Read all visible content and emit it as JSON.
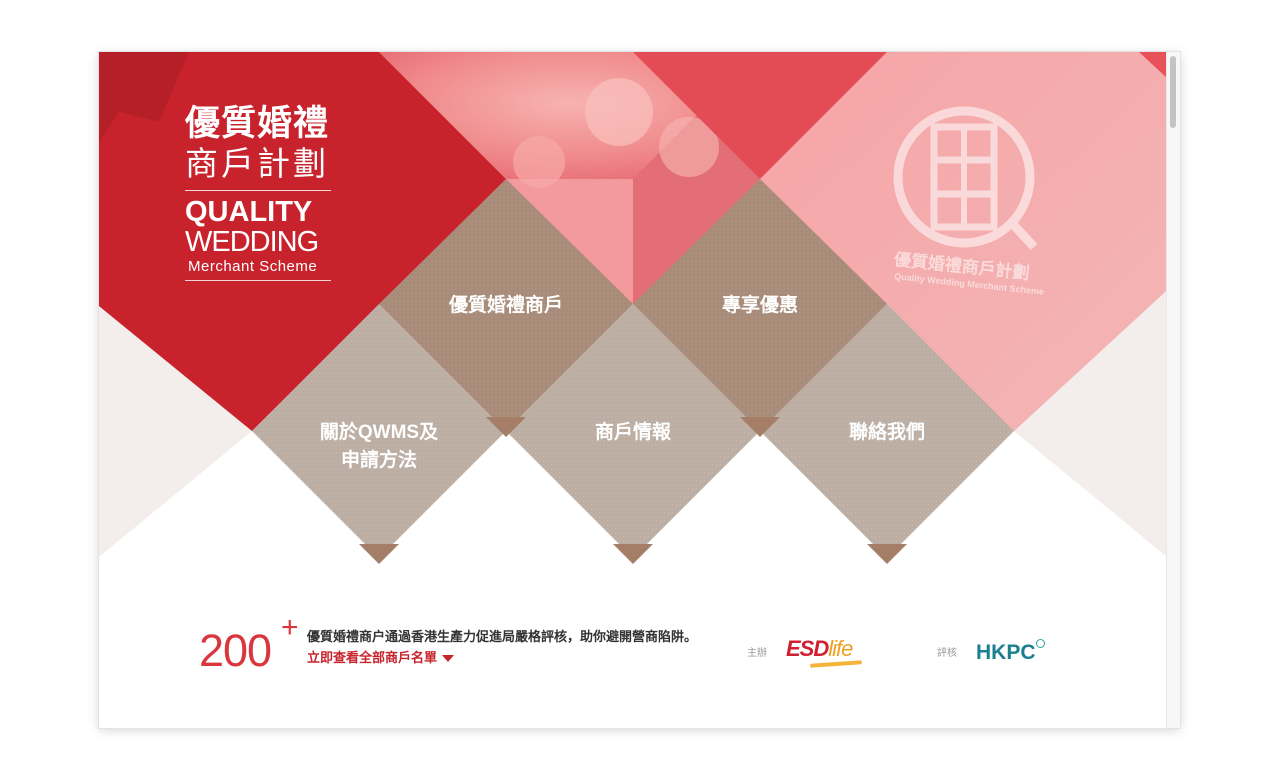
{
  "logo": {
    "title_zh_line1": "優質婚禮",
    "title_zh_line2": "商戶計劃",
    "title_en_line1": "QUALITY",
    "title_en_line2": "WEDDING",
    "title_en_line3": "Merchant Scheme"
  },
  "hero_stamp": {
    "zh": "優質婚禮商戶計劃",
    "en": "Quality Wedding Merchant Scheme"
  },
  "nav": {
    "merchants": "優質婚禮商戶",
    "offers": "專享優惠",
    "about_line1": "關於QWMS及",
    "about_line2": "申請方法",
    "merchant_info": "商戶情報",
    "contact": "聯絡我們"
  },
  "footer": {
    "count": "200",
    "count_suffix": "+",
    "description": "優質婚禮商户通過香港生產力促進局嚴格評核，助你避開營商陷阱。",
    "view_all_link": "立即查看全部商戶名單",
    "organiser_label": "主辦",
    "organiser_logo_text": "ESD",
    "organiser_logo_text2": "life",
    "assessor_label": "評核",
    "assessor_logo_text": "HKPC"
  },
  "colors": {
    "red_primary": "#c8232c",
    "brown_tile": "#a88b78",
    "taupe_tile": "#bcaea3",
    "accent_red": "#d9363e",
    "hkpc_teal": "#1a7f8e"
  }
}
